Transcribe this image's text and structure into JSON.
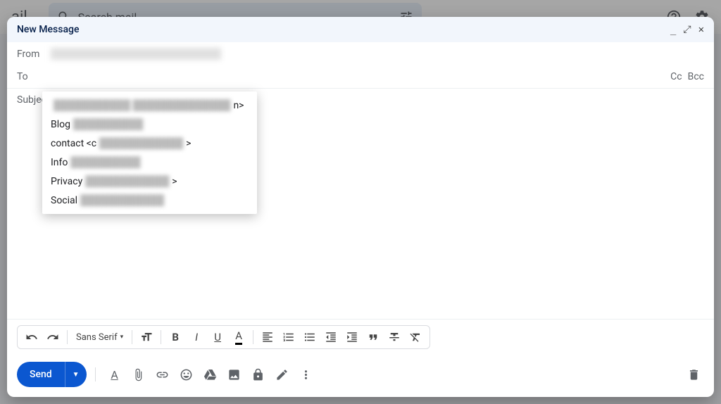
{
  "bg": {
    "logo_end": "ail",
    "search_placeholder": "Search mail"
  },
  "compose": {
    "title": "New Message",
    "from_label": "From",
    "from_value": "████████  ████████████████",
    "to_label": "To",
    "cc": "Cc",
    "bcc": "Bcc",
    "subject_label": "Subject"
  },
  "suggestions": [
    {
      "label": "",
      "blur": "███████████  ██████████████",
      "suffix": "n>"
    },
    {
      "label": "Blog ",
      "blur": "██████████",
      "suffix": ""
    },
    {
      "label": "contact <c",
      "blur": "████████████",
      "suffix": ">"
    },
    {
      "label": "Info ",
      "blur": "██████████",
      "suffix": ""
    },
    {
      "label": "Privacy ",
      "blur": "████████████",
      "suffix": ">"
    },
    {
      "label": "Social ",
      "blur": "████████████",
      "suffix": ""
    }
  ],
  "toolbar": {
    "font": "Sans Serif",
    "send": "Send"
  }
}
